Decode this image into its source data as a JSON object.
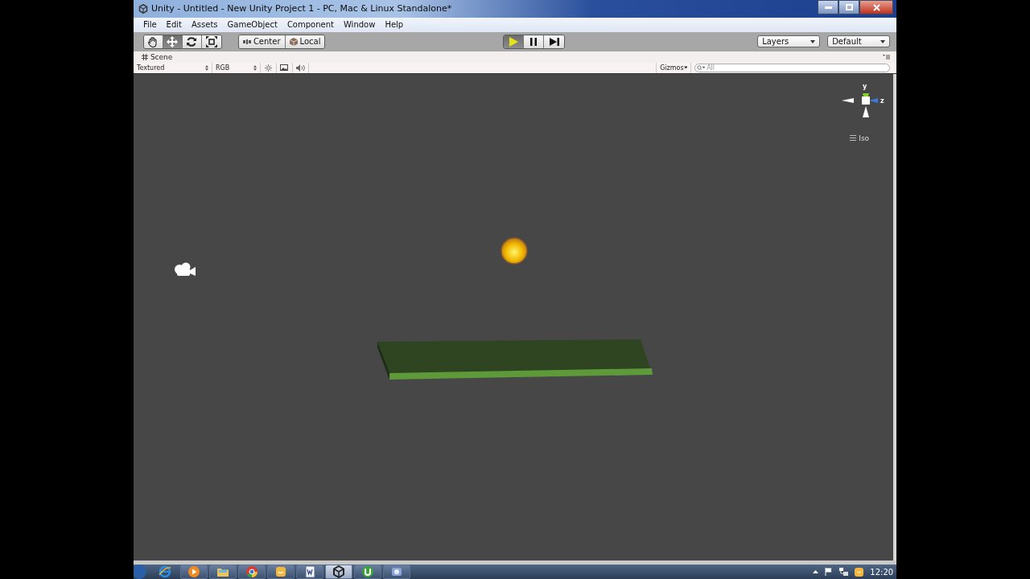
{
  "window": {
    "title": "Unity - Untitled - New Unity Project 1 - PC, Mac & Linux Standalone*"
  },
  "menu": [
    "File",
    "Edit",
    "Assets",
    "GameObject",
    "Component",
    "Window",
    "Help"
  ],
  "toolbar": {
    "tools": [
      {
        "kind": "hand",
        "selected": false
      },
      {
        "kind": "move",
        "selected": true
      },
      {
        "kind": "rotate",
        "selected": false
      },
      {
        "kind": "scale",
        "selected": false
      }
    ],
    "pivot": [
      {
        "kind": "center",
        "label": "Center"
      },
      {
        "kind": "local",
        "label": "Local"
      }
    ],
    "playback": [
      {
        "kind": "play",
        "selected": true
      },
      {
        "kind": "pause",
        "selected": false
      },
      {
        "kind": "step",
        "selected": false
      }
    ],
    "layers": "Layers",
    "layout": "Default"
  },
  "scene": {
    "tab": "Scene",
    "render_mode": "Textured",
    "channel": "RGB",
    "gizmos": "Gizmos",
    "search": {
      "placeholder": "All"
    },
    "axes": [
      "y",
      "z"
    ],
    "projection": "Iso"
  },
  "taskbar": {
    "apps": [
      {
        "kind": "browser",
        "selected": false
      },
      {
        "kind": "media",
        "selected": false
      },
      {
        "kind": "folder",
        "selected": false
      },
      {
        "kind": "chrome",
        "selected": false
      },
      {
        "kind": "chat",
        "selected": false
      },
      {
        "kind": "doc",
        "selected": false
      },
      {
        "kind": "unity",
        "selected": true
      },
      {
        "kind": "torrent",
        "selected": false
      },
      {
        "kind": "tool",
        "selected": false
      }
    ],
    "clock": "12:20"
  }
}
